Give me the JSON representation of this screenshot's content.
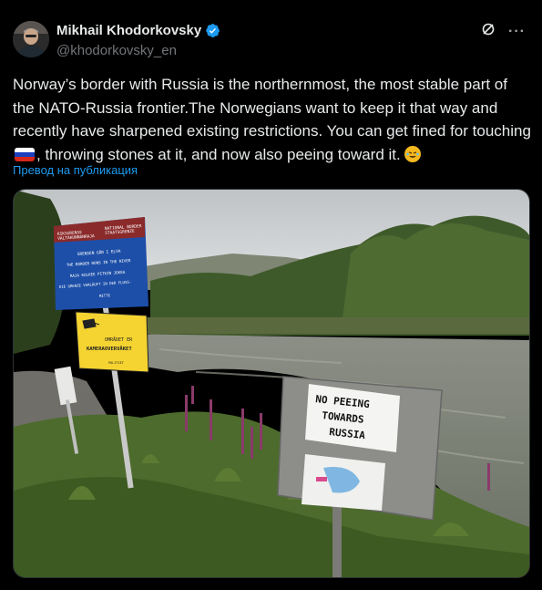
{
  "author": {
    "display_name": "Mikhail Khodorkovsky",
    "handle": "@khodorkovsky_en",
    "verified": true,
    "avatar_icon": "avatar-photo"
  },
  "actions": {
    "grok_icon": "grok-icon",
    "more_icon": "more-icon",
    "more_label": "···"
  },
  "post": {
    "text_before_flag": "Norway’s border with Russia is the northernmost, the most stable part of the NATO-Russia frontier.The Norwegians want to keep it that way and recently have sharpened existing restrictions. You can get fined for touching ",
    "flag_icon": "russian-flag-emoji",
    "text_after_flag": ", throwing stones at it, and now also peeing toward it. ",
    "end_emoji_icon": "rolling-laughing-emoji",
    "translate_label": "Превод на публикация"
  },
  "image": {
    "border_sign": {
      "header_left": "RIKSGRENSE\nVALTAKUNNANRAJA",
      "header_right": "NATIONAL BORDER\nSTAATSGRENZE",
      "lines": [
        "GRENSEN GÅR I ELVA",
        "THE BORDER RUNS IN THE RIVER",
        "RAJA KULKEE PITKIN JOKEA",
        "DIE GRENZE VERLÄUFT IN DER FLUSS-",
        "MITTE"
      ]
    },
    "camera_sign": {
      "line1": "OMRÅDET ER",
      "line2": "KAMERAOVERVÅKET",
      "small": "POLITIET"
    },
    "peeing_sign": {
      "line1": "NO PEEING",
      "line2": "TOWARDS",
      "line3": "RUSSIA"
    }
  },
  "colors": {
    "background": "#000000",
    "text": "#e7e9ea",
    "muted": "#71767b",
    "link": "#1d9bf0",
    "verified": "#1d9bf0"
  }
}
